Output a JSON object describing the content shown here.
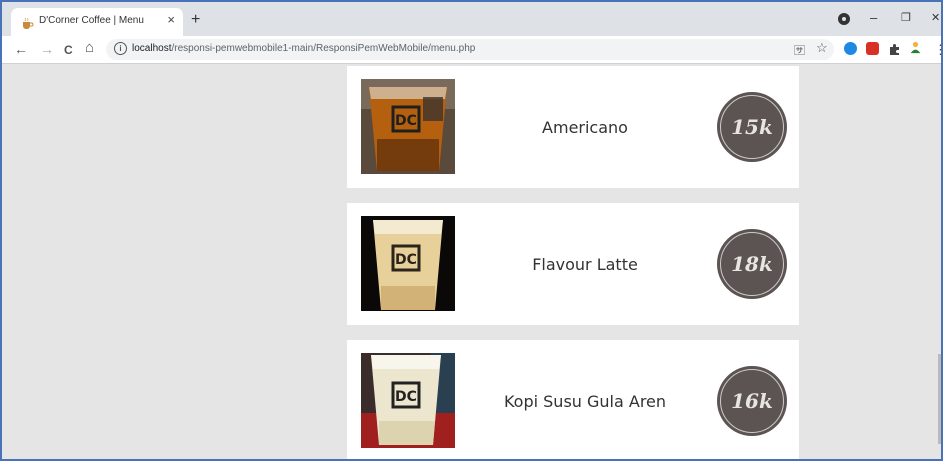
{
  "browser": {
    "tab": {
      "title": "D'Corner Coffee | Menu",
      "close_label": "×",
      "new_tab_label": "+"
    },
    "window_controls": {
      "minimize": "–",
      "restore": "❐",
      "close": "✕"
    },
    "nav": {
      "back": "←",
      "forward": "→",
      "reload": "C",
      "home": "⌂"
    },
    "address": {
      "info": "i",
      "host": "localhost",
      "path": "/responsi-pemwebmobile1-main/ResponsiPemWebMobile/menu.php"
    },
    "omnibox_icons": {
      "translate": "🈂",
      "bookmark": "☆"
    },
    "extensions": {
      "menu": "⋮"
    }
  },
  "menu": {
    "items": [
      {
        "name": "Americano",
        "price": "15k",
        "image": "americano-cup"
      },
      {
        "name": "Flavour Latte",
        "price": "18k",
        "image": "latte-cup"
      },
      {
        "name": "Kopi Susu Gula Aren",
        "price": "16k",
        "image": "kopi-susu-cup"
      }
    ]
  },
  "colors": {
    "page_bg": "#e5e5e5",
    "card_bg": "#ffffff",
    "badge_bg": "#5b5452",
    "window_border": "#4a72b8"
  }
}
